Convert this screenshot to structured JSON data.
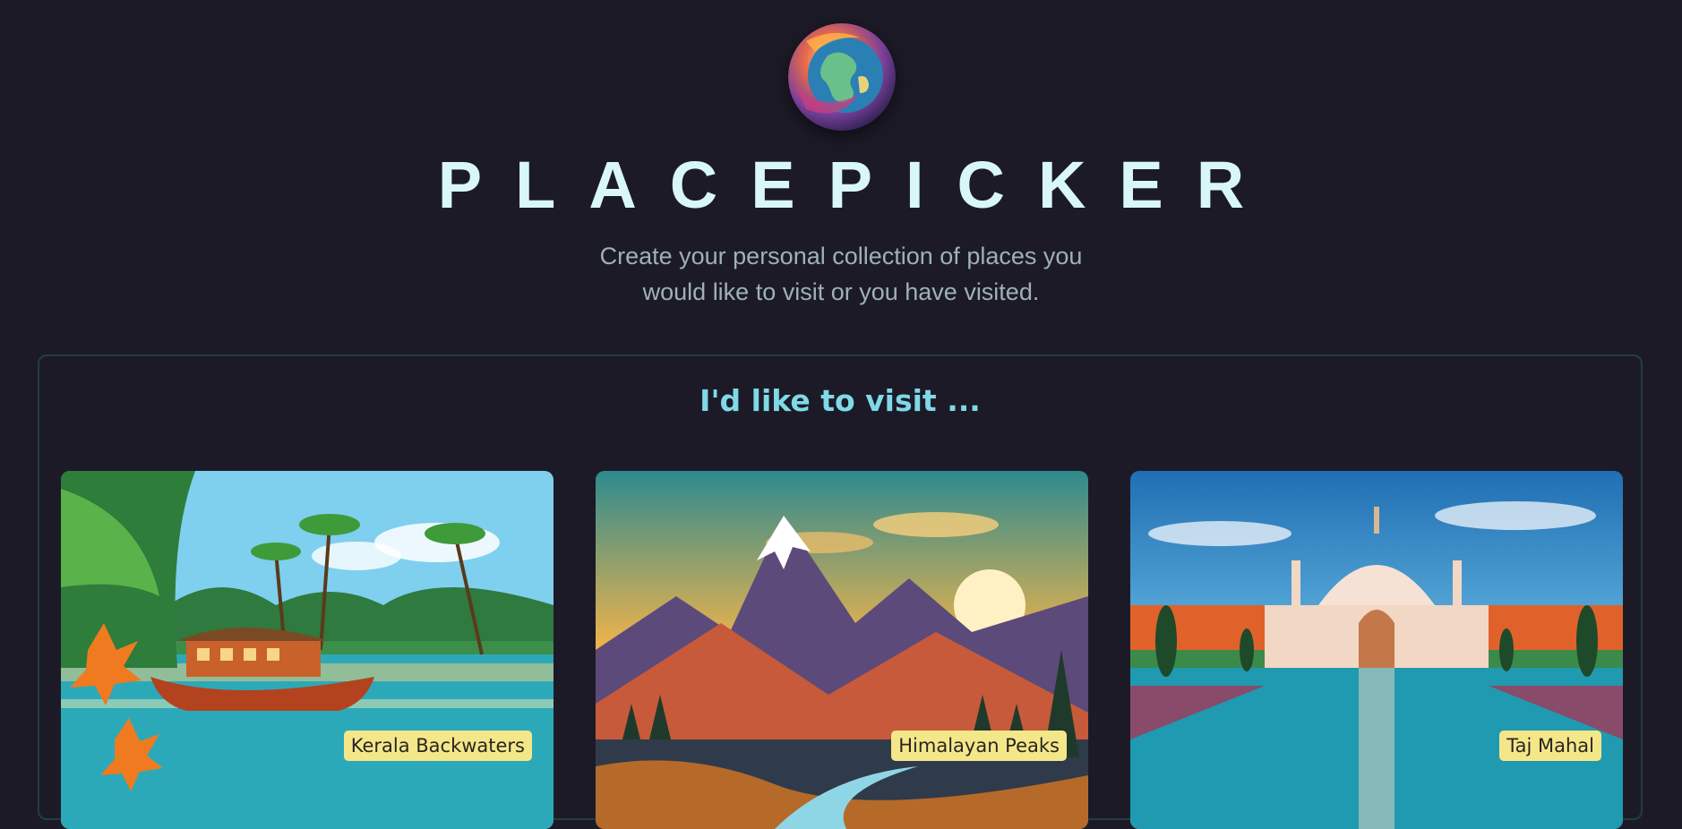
{
  "header": {
    "logo_icon": "globe-icon",
    "title": "PLACEPICKER",
    "tagline": "Create your personal collection of places you would like to visit or you have visited."
  },
  "section": {
    "heading": "I'd like to visit ..."
  },
  "places": [
    {
      "title": "Kerala Backwaters"
    },
    {
      "title": "Himalayan Peaks"
    },
    {
      "title": "Taj Mahal"
    }
  ],
  "colors": {
    "background": "#1d1a27",
    "title": "#d9f7f8",
    "heading": "#7fd9e7",
    "label_bg": "#f4e78a"
  }
}
